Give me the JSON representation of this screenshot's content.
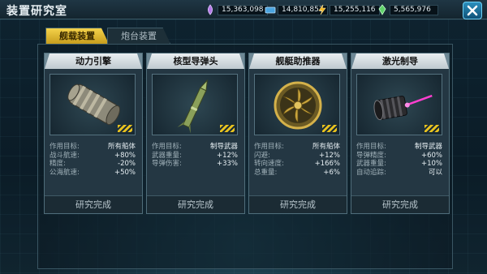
{
  "header": {
    "title": "装置研究室",
    "resources": [
      {
        "icon": "purple-crystal-icon",
        "value": "15,363,098",
        "color": "#b47ae8"
      },
      {
        "icon": "blue-bar-icon",
        "value": "14,810,853",
        "color": "#4aa4e0"
      },
      {
        "icon": "lightning-icon",
        "value": "15,255,116",
        "color": "#f0b422"
      },
      {
        "icon": "green-crystal-icon",
        "value": "5,565,976",
        "color": "#5fd06a"
      }
    ],
    "close_icon": "close-icon"
  },
  "tabs": [
    {
      "label": "舰载装置",
      "active": true
    },
    {
      "label": "炮台装置",
      "active": false
    }
  ],
  "cards": [
    {
      "title": "动力引擎",
      "image": "engine-image",
      "stats": [
        {
          "k": "作用目标:",
          "v": "所有船体"
        },
        {
          "k": "战斗航速:",
          "v": "+80%"
        },
        {
          "k": "精度:",
          "v": "-20%"
        },
        {
          "k": "公海航速:",
          "v": "+50%"
        }
      ],
      "status": "研究完成"
    },
    {
      "title": "核型导弹头",
      "image": "missile-image",
      "stats": [
        {
          "k": "作用目标:",
          "v": "制导武器"
        },
        {
          "k": "武器重量:",
          "v": "+12%"
        },
        {
          "k": "导弹伤害:",
          "v": "+33%"
        }
      ],
      "status": "研究完成"
    },
    {
      "title": "舰艇助推器",
      "image": "propeller-image",
      "stats": [
        {
          "k": "作用目标:",
          "v": "所有船体"
        },
        {
          "k": "闪避:",
          "v": "+12%"
        },
        {
          "k": "转向速度:",
          "v": "+166%"
        },
        {
          "k": "总重量:",
          "v": "+6%"
        }
      ],
      "status": "研究完成"
    },
    {
      "title": "激光制导",
      "image": "laser-image",
      "stats": [
        {
          "k": "作用目标:",
          "v": "制导武器"
        },
        {
          "k": "导弹精度:",
          "v": "+60%"
        },
        {
          "k": "武器重量:",
          "v": "+10%"
        },
        {
          "k": "自动追踪:",
          "v": "可以"
        }
      ],
      "status": "研究完成"
    }
  ]
}
